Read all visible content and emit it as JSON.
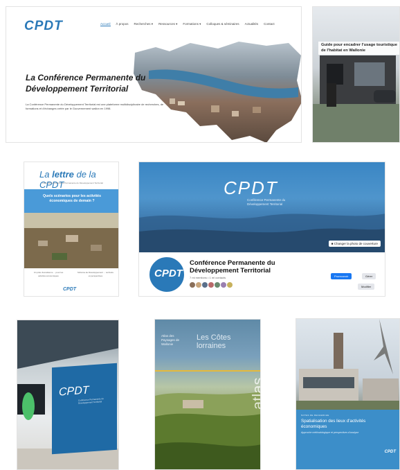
{
  "tiles": {
    "website": {
      "logo": "CPDT",
      "nav": [
        "Accueil",
        "À propos",
        "Recherches ▾",
        "Ressources ▾",
        "Formations ▾",
        "Colloques & séminaires",
        "Actualités",
        "Contact"
      ],
      "title": "La Conférence Permanente du Développement Territorial",
      "description": "La Conférence Permanente du Développement Territorial est une plateforme multidisciplinaire de recherches, de formations et d'échanges créée par le Gouvernement wallon en 1998."
    },
    "habitat": {
      "title": "Guide pour encadrer l'usage touristique de l'habitat en Wallonie"
    },
    "lettre": {
      "title_prefix": "La ",
      "title_main": "lettre",
      "title_suffix": " de la CPDT",
      "subtitle": "Lettre de la Conférence Permanente du Développement Territorial",
      "question": "Quels scénarios pour les activités économiques de demain ?",
      "col1": "Un pôle d'excellence ... pour les activités économiques",
      "col2": "Schéma de Développement ... territoire et perspectives",
      "footer_logo": "CPDT"
    },
    "facebook": {
      "cover_logo": "CPDT",
      "cover_subtitle": "Conférence Permanente du Développement Territorial",
      "cover_button": "Changer la photo de couverture",
      "avatar_logo": "CPDT",
      "page_name": "Conférence Permanente du Développement Territorial",
      "meta": "7 ml mentions • 1 ml contacts",
      "btn_primary": "Promouvoir",
      "btn_secondary": "Gérer",
      "btn_tertiary": "Modifier"
    },
    "banner": {
      "logo": "CPDT",
      "subtitle": "Conférence Permanente du Développement Territorial"
    },
    "atlas": {
      "series": "Atlas des Paysages de Wallonie",
      "title": "Les Côtes lorraines",
      "spine": "atlas"
    },
    "spatialisation": {
      "kicker": "NOTES DE RECHERCHE",
      "title": "Spatialisation des lieux d'activités économiques",
      "subtitle": "Approche méthodologique et perspectives d'analyse",
      "logo": "CPDT"
    }
  },
  "colors": {
    "brand_blue": "#2a79b8",
    "facebook_blue": "#1877f2"
  }
}
